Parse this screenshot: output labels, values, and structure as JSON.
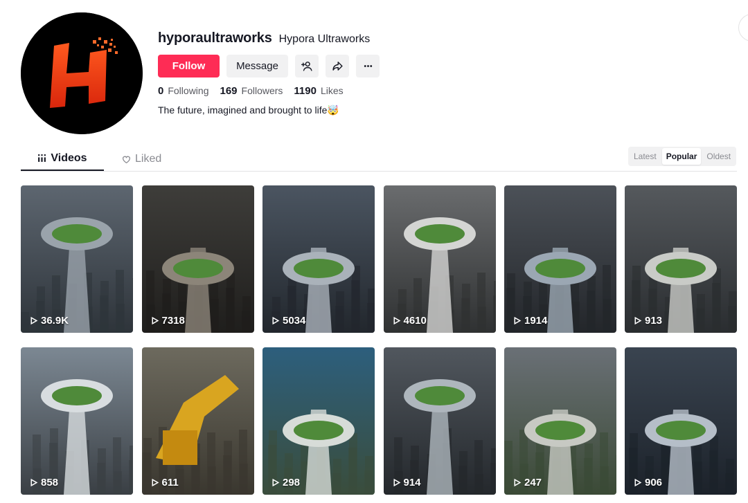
{
  "profile": {
    "username": "hyporaultraworks",
    "nickname": "Hypora Ultraworks",
    "bio": "The future, imagined and brought to life🤯",
    "stats": {
      "following_count": "0",
      "following_label": "Following",
      "followers_count": "169",
      "followers_label": "Followers",
      "likes_count": "1190",
      "likes_label": "Likes"
    },
    "avatar_letter": "H"
  },
  "actions": {
    "follow_label": "Follow",
    "message_label": "Message",
    "add_friend_icon": "add-user-icon",
    "share_icon": "share-icon",
    "more_icon": "more-icon"
  },
  "tabs": {
    "videos_label": "Videos",
    "liked_label": "Liked"
  },
  "sort": {
    "options": [
      "Latest",
      "Popular",
      "Oldest"
    ],
    "selected": "Popular"
  },
  "videos": [
    {
      "views": "36.9K",
      "scene": "city tower stadium"
    },
    {
      "views": "7318",
      "scene": "city tower stadium"
    },
    {
      "views": "5034",
      "scene": "city tower stadium"
    },
    {
      "views": "4610",
      "scene": "dome stadium"
    },
    {
      "views": "1914",
      "scene": "city tower stadium"
    },
    {
      "views": "913",
      "scene": "elevated stadium"
    },
    {
      "views": "858",
      "scene": "capitol stadium"
    },
    {
      "views": "611",
      "scene": "excavator"
    },
    {
      "views": "298",
      "scene": "coastal stadium"
    },
    {
      "views": "914",
      "scene": "city tower stadium"
    },
    {
      "views": "247",
      "scene": "green tower stadium"
    },
    {
      "views": "906",
      "scene": "glass tower stadium"
    }
  ],
  "colors": {
    "brand": "#fe2c55",
    "text": "#161823",
    "secondary": "#8a8b91"
  }
}
